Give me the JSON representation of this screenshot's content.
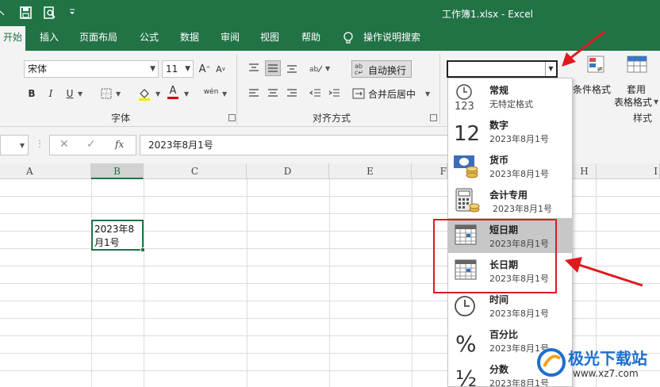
{
  "titlebar": {
    "title": "工作簿1.xlsx  -  Excel",
    "quick_access": [
      "save-icon",
      "print-preview-icon",
      "customize-icon"
    ]
  },
  "tabs": [
    {
      "label": "开始",
      "active": true
    },
    {
      "label": "插入"
    },
    {
      "label": "页面布局"
    },
    {
      "label": "公式"
    },
    {
      "label": "数据"
    },
    {
      "label": "审阅"
    },
    {
      "label": "视图"
    },
    {
      "label": "帮助"
    },
    {
      "label": "操作说明搜索"
    }
  ],
  "ribbon": {
    "font_name": "宋体",
    "font_size": "11",
    "bold": "B",
    "italic": "I",
    "underline": "U",
    "font_color_letter": "A",
    "phonetic": "wén",
    "font_group_label": "字体",
    "wrap_text": "自动换行",
    "merge_center": "合并后居中",
    "align_group_label": "对齐方式",
    "number_format_value": "",
    "cond_format": "条件格式",
    "table_format_1": "套用",
    "table_format_2": "表格格式",
    "styles_group_label": "样式"
  },
  "formula_bar": {
    "fx": "fx",
    "content": "2023年8月1号"
  },
  "columns": [
    {
      "label": "A"
    },
    {
      "label": "B",
      "selected": true
    },
    {
      "label": "C"
    },
    {
      "label": "D"
    },
    {
      "label": "E"
    },
    {
      "label": "F"
    },
    {
      "label": "H"
    },
    {
      "label": "I"
    }
  ],
  "cell_b": {
    "line1": "2023年8",
    "line2": "月1号"
  },
  "format_menu": [
    {
      "name": "常规",
      "example": "无特定格式",
      "icon": "clock-123-icon"
    },
    {
      "name": "数字",
      "example": "2023年8月1号",
      "icon": "number-12-icon"
    },
    {
      "name": "货币",
      "example": "2023年8月1号",
      "icon": "currency-icon"
    },
    {
      "name": "会计专用",
      "example": "2023年8月1号",
      "icon": "accounting-icon"
    },
    {
      "name": "短日期",
      "example": "2023年8月1号",
      "icon": "short-date-calendar-icon",
      "highlighted": true
    },
    {
      "name": "长日期",
      "example": "2023年8月1号",
      "icon": "long-date-calendar-icon"
    },
    {
      "name": "时间",
      "example": "2023年8月1号",
      "icon": "clock-icon"
    },
    {
      "name": "百分比",
      "example": "2023年8月1号",
      "icon": "percent-icon"
    },
    {
      "name": "分数",
      "example": "2023年8月1号",
      "icon": "fraction-icon"
    }
  ],
  "watermark": {
    "brand": "极光下载站",
    "url": "www.xz7.com"
  },
  "colors": {
    "excel_green": "#217346",
    "annotation_red": "#e0191e",
    "highlight_gray": "#c7c7c7"
  }
}
